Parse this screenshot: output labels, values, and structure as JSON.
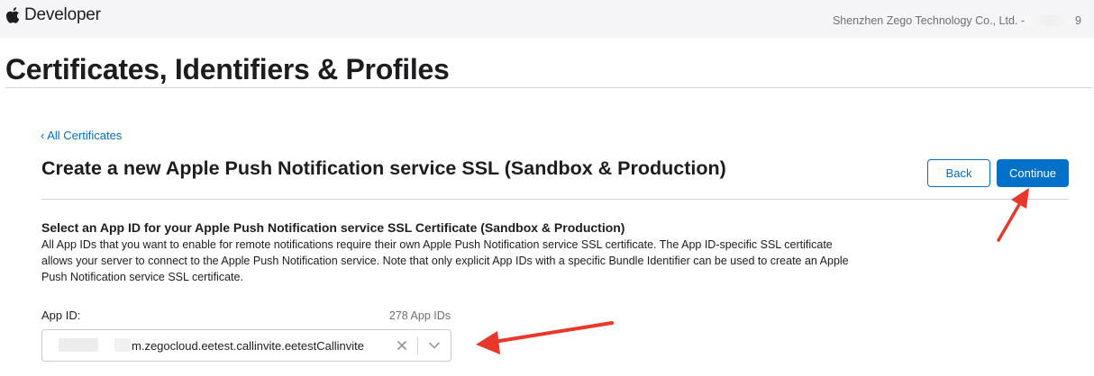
{
  "header": {
    "brand_label": "Developer",
    "account_name": "Shenzhen Zego Technology Co., Ltd. -",
    "account_suffix": "9"
  },
  "page": {
    "title": "Certificates, Identifiers & Profiles"
  },
  "content": {
    "back_link": "‹ All Certificates",
    "section_title": "Create a new Apple Push Notification service SSL (Sandbox & Production)",
    "back_button": "Back",
    "continue_button": "Continue",
    "sub_heading": "Select an App ID for your Apple Push Notification service SSL Certificate (Sandbox & Production)",
    "description": "All App IDs that you want to enable for remote notifications require their own Apple Push Notification service SSL certificate. The App ID-specific SSL certificate allows your server to connect to the Apple Push Notification service. Note that only explicit App IDs with a specific Bundle Identifier can be used to create an Apple Push Notification service SSL certificate."
  },
  "app_id_field": {
    "label": "App ID:",
    "count": "278 App IDs",
    "selected_value": "m.zegocloud.eetest.callinvite.eetestCallinvite"
  },
  "icons": {
    "brand": "apple-logo-icon",
    "clear": "close-icon",
    "dropdown": "chevron-down-icon"
  },
  "colors": {
    "accent": "#0070c9",
    "annotation_arrow": "#e8382c",
    "header_bg": "#f5f5f7"
  }
}
